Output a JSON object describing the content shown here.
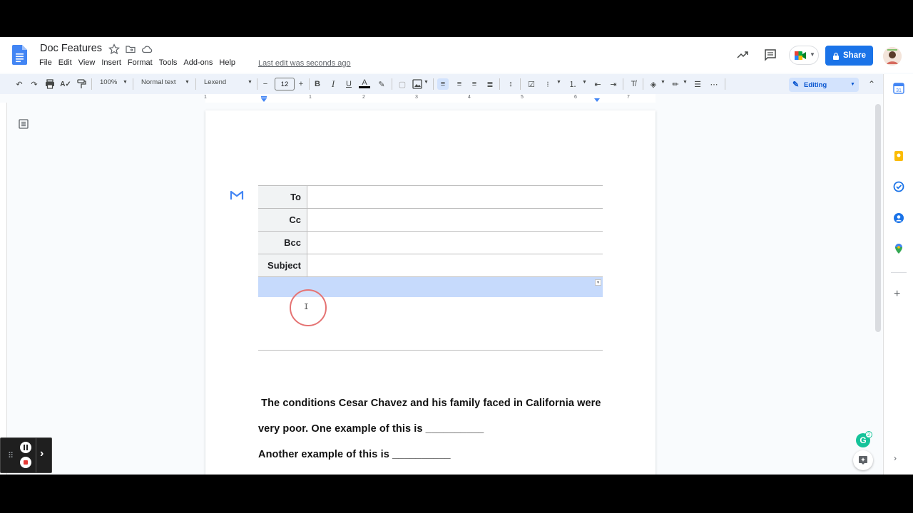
{
  "app": {
    "doc_title": "Doc Features",
    "menu": [
      "File",
      "Edit",
      "View",
      "Insert",
      "Format",
      "Tools",
      "Add-ons",
      "Help"
    ],
    "last_edit": "Last edit was seconds ago",
    "share_label": "Share"
  },
  "toolbar": {
    "zoom": "100%",
    "style": "Normal text",
    "font": "Lexend",
    "font_size": "12",
    "mode": "Editing"
  },
  "ruler": {
    "numbers": [
      "1",
      "1",
      "2",
      "3",
      "4",
      "5",
      "6",
      "7"
    ]
  },
  "email_draft": {
    "fields": [
      {
        "label": "To",
        "value": ""
      },
      {
        "label": "Cc",
        "value": ""
      },
      {
        "label": "Bcc",
        "value": ""
      },
      {
        "label": "Subject",
        "value": ""
      }
    ],
    "body": ""
  },
  "document": {
    "lines": [
      " The conditions Cesar Chavez and his family faced in California were",
      "very poor. One example of this is __________",
      "Another example of this is __________"
    ]
  },
  "grammarly": {
    "logo": "G",
    "badge_count": "2"
  },
  "colors": {
    "accent": "#1a73e8",
    "selection": "#c6dafc",
    "editing_bg": "#d3e3fd",
    "recording_ring": "#e57373"
  }
}
